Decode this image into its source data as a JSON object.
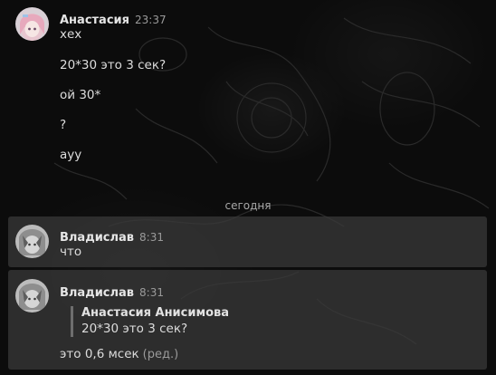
{
  "messages": [
    {
      "author": "Анастасия",
      "time": "23:37",
      "lines": [
        "хех",
        "20*30 это 3 сек?",
        "ой 30*",
        "?",
        "ауу"
      ]
    },
    {
      "author": "Владислав",
      "time": "8:31",
      "lines": [
        "что"
      ]
    },
    {
      "author": "Владислав",
      "time": "8:31",
      "reply": {
        "author": "Анастасия Анисимова",
        "text": "20*30 это 3 сек?"
      },
      "text": "это 0,6 мсек",
      "edited_label": "(ред.)"
    }
  ],
  "divider": "сегодня",
  "colors": {
    "background": "#0c0c0c",
    "highlight": "#3a3a3a",
    "text": "#dcdcdc",
    "muted": "#9a9a9a"
  },
  "icons": {
    "avatar_anastasia": "avatar-anime-girl-pink-hair",
    "avatar_vladislav": "avatar-anime-grayscale"
  }
}
